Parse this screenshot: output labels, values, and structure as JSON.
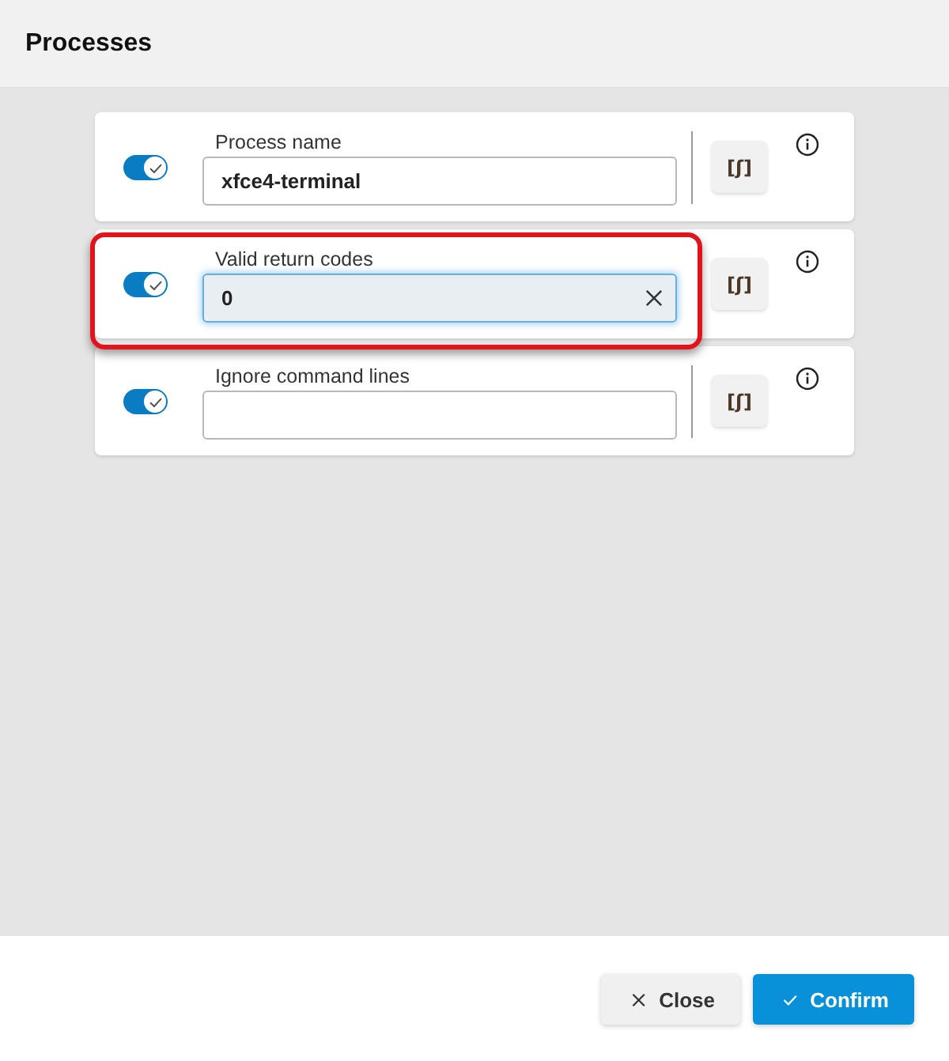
{
  "dialog": {
    "title": "Processes"
  },
  "rows": [
    {
      "enabled": true,
      "label": "Process name",
      "value": "xfce4-terminal",
      "focused": false,
      "divider": true,
      "highlighted": false,
      "script_button": "[ʃ]"
    },
    {
      "enabled": true,
      "label": "Valid return codes",
      "value": "0",
      "focused": true,
      "divider": false,
      "highlighted": true,
      "script_button": "[ʃ]"
    },
    {
      "enabled": true,
      "label": "Ignore command lines",
      "focused": false,
      "divider": true,
      "highlighted": false,
      "script_button": "[ʃ]"
    }
  ],
  "buttons": [
    {
      "kind": "secondary",
      "label": "Close"
    },
    {
      "kind": "primary",
      "label": "Confirm"
    }
  ]
}
